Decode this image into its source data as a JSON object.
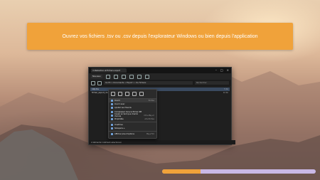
{
  "banner": {
    "text": "Ouvrez vos fichiers .tsv ou .csv depuis l'explorateur Windows ou bien depuis l'application"
  },
  "window": {
    "tab_title": "m Rédaction et fichiers export",
    "new_button": "Nouveau",
    "address": "Ce PC > Documents > Export > .tsv fichiers",
    "search_placeholder": "Rechercher",
    "files": [
      {
        "name": "ratp.tsv",
        "size": "5 Ko"
      },
      {
        "name": "fichier_export_donnees.csv",
        "size": "12 Ko"
      }
    ],
    "status": "2 éléments  1 élément sélectionné"
  },
  "context_menu": {
    "items": [
      {
        "label": "Ouvrir",
        "shortcut": "Entrée"
      },
      {
        "label": "Ouvrir avec",
        "shortcut": ""
      },
      {
        "label": "Ajouter aux favoris",
        "shortcut": ""
      },
      {
        "label": "Compresser dans le fichier ZIP",
        "shortcut": ""
      },
      {
        "label": "Copier en tant que chemin d'accès",
        "shortcut": "Ctrl+Maj+C"
      },
      {
        "label": "Propriétés",
        "shortcut": "Alt+Entrée"
      },
      {
        "label": "OneDrive",
        "shortcut": ""
      },
      {
        "label": "Notepad++",
        "shortcut": ""
      },
      {
        "label": "Afficher plus d'options",
        "shortcut": "Maj+F10"
      }
    ]
  },
  "progress": {
    "fraction": 0.25
  },
  "colors": {
    "accent": "#f0a23a",
    "track": "#c9b8e6"
  }
}
